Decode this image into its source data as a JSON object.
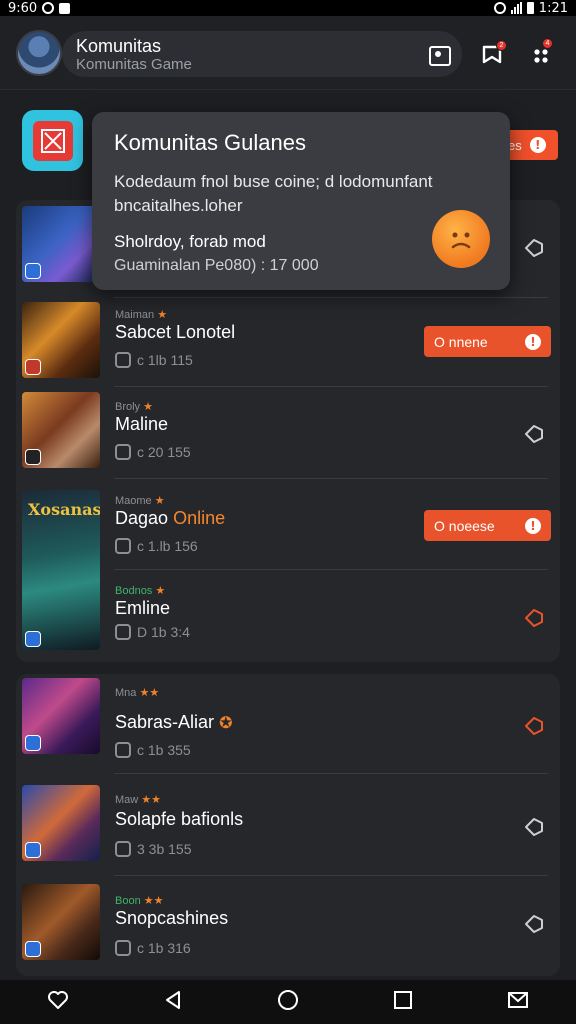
{
  "status_bar": {
    "time_left": "9:60",
    "time_right": "1:21"
  },
  "header": {
    "title": "Komunitas",
    "subtitle": "Komunitas Game",
    "notif_badge": "2",
    "more_badge": "4"
  },
  "app": {
    "top_button_label": "es"
  },
  "popup": {
    "title": "Komunitas Gulanes",
    "body": "Kodedaum fnol buse coine; d lodomunfant bncaitalhes.loher",
    "line1": "Sholrdoy, forab mod",
    "line2": "Guaminalan Pe080) : 17 000"
  },
  "list": [
    {
      "genre": "",
      "name": "",
      "meta": "",
      "button": ""
    },
    {
      "genre": "Maiman",
      "name": "Sabcet Lonotel",
      "meta": "c 1lb 115",
      "button": "O nnene"
    },
    {
      "genre": "Broly",
      "name": "Maline",
      "meta": "c 20 155",
      "button": ""
    },
    {
      "genre": "Maome",
      "name": "Dagao",
      "name_accent": "Online",
      "meta": "c 1.lb 156",
      "button": "O noeese",
      "thumb_title": "Xosanas"
    },
    {
      "genre": "Bodnos",
      "name": "Emline",
      "meta": "D 1b 3:4",
      "button": ""
    },
    {
      "genre": "Mna",
      "name": "Sabras-Aliar",
      "meta": "c 1b 355",
      "button": ""
    },
    {
      "genre": "Maw",
      "name": "Solapfe bafionls",
      "meta": "3 3b 155",
      "button": ""
    },
    {
      "genre": "Boon",
      "name": "Snopcashines",
      "meta": "c 1b 316",
      "button": ""
    }
  ],
  "colors": {
    "accent_orange": "#e9532b",
    "background": "#1e1f22",
    "card": "#26272b"
  },
  "icons": [
    "camera-icon",
    "notification-icon",
    "more-icon",
    "info-icon",
    "tag-icon",
    "heart-icon",
    "back-icon",
    "home-icon",
    "recents-icon",
    "mail-icon"
  ]
}
